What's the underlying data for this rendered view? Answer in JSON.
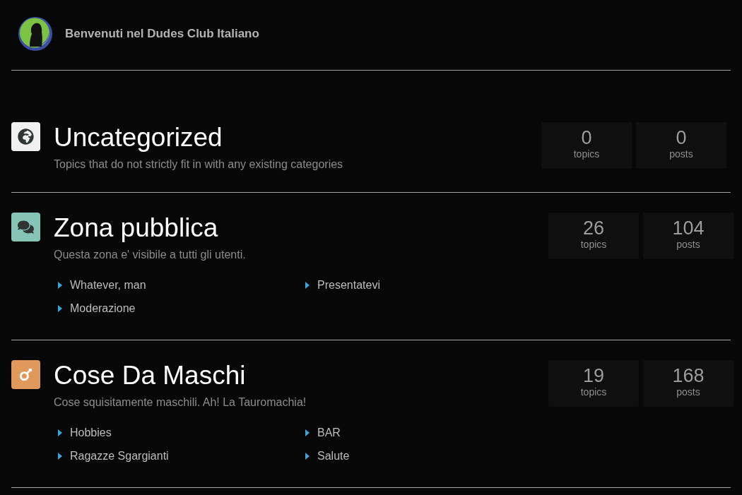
{
  "header": {
    "title": "Benvenuti nel Dudes Club Italiano"
  },
  "categories": [
    {
      "title": "Uncategorized",
      "description": "Topics that do not strictly fit in with any existing categories",
      "color": "#f0f0f0",
      "stats": [
        {
          "value": "0",
          "label": "topics"
        },
        {
          "value": "0",
          "label": "posts"
        }
      ]
    },
    {
      "title": "Zona pubblica",
      "description": "Questa zona e' visibile a tutti gli utenti.",
      "color": "#85c4b6",
      "stats": [
        {
          "value": "26",
          "label": "topics"
        },
        {
          "value": "104",
          "label": "posts"
        }
      ],
      "subcategories": [
        "Whatever, man",
        "Presentatevi",
        "Moderazione"
      ]
    },
    {
      "title": "Cose Da Maschi",
      "description": "Cose squisitamente maschili. Ah! La Tauromachia!",
      "color": "#e0995a",
      "stats": [
        {
          "value": "19",
          "label": "topics"
        },
        {
          "value": "168",
          "label": "posts"
        }
      ],
      "subcategories": [
        "Hobbies",
        "BAR",
        "Ragazze Sgargianti",
        "Salute"
      ]
    }
  ]
}
